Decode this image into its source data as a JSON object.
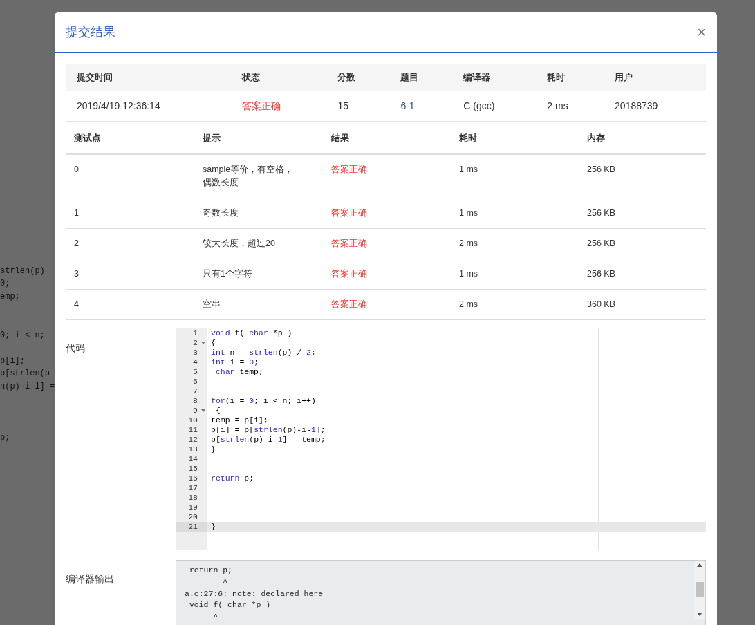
{
  "background_code": [
    [
      "strlen(p)",
      "0;",
      "emp;"
    ],
    [
      "0; i < n;"
    ],
    [
      "p[i];",
      "p[strlen(p",
      "n(p)-i-1] ="
    ],
    [
      "p;"
    ]
  ],
  "modal": {
    "title": "提交结果",
    "close": "×"
  },
  "summary": {
    "columns": [
      "提交时间",
      "状态",
      "分数",
      "题目",
      "编译器",
      "耗时",
      "用户"
    ],
    "row": [
      {
        "text": "2019/4/19 12:36:14",
        "kind": "plain"
      },
      {
        "text": "答案正确",
        "kind": "status"
      },
      {
        "text": "15",
        "kind": "plain"
      },
      {
        "text": "6-1",
        "kind": "link"
      },
      {
        "text": "C (gcc)",
        "kind": "plain"
      },
      {
        "text": "2 ms",
        "kind": "plain"
      },
      {
        "text": "20188739",
        "kind": "plain"
      }
    ]
  },
  "tests": {
    "columns": [
      "测试点",
      "提示",
      "结果",
      "耗时",
      "内存"
    ],
    "rows": [
      {
        "id": "0",
        "hint": "sample等价，有空格，偶数长度",
        "result": "答案正确",
        "time": "1 ms",
        "memory": "256 KB"
      },
      {
        "id": "1",
        "hint": "奇数长度",
        "result": "答案正确",
        "time": "1 ms",
        "memory": "256 KB"
      },
      {
        "id": "2",
        "hint": "较大长度，超过20",
        "result": "答案正确",
        "time": "2 ms",
        "memory": "256 KB"
      },
      {
        "id": "3",
        "hint": "只有1个字符",
        "result": "答案正确",
        "time": "1 ms",
        "memory": "256 KB"
      },
      {
        "id": "4",
        "hint": "空串",
        "result": "答案正确",
        "time": "2 ms",
        "memory": "360 KB"
      }
    ]
  },
  "code": {
    "label": "代码",
    "lines": [
      {
        "number": "1",
        "fold": false,
        "active": false,
        "tokens": [
          {
            "t": "void",
            "kind": "keyword"
          },
          {
            "t": " f( ",
            "kind": "plain"
          },
          {
            "t": "char",
            "kind": "keyword"
          },
          {
            "t": " *p )",
            "kind": "plain"
          }
        ]
      },
      {
        "number": "2",
        "fold": true,
        "active": false,
        "tokens": [
          {
            "t": "{",
            "kind": "plain"
          }
        ]
      },
      {
        "number": "3",
        "fold": false,
        "active": false,
        "tokens": [
          {
            "t": "int",
            "kind": "keyword"
          },
          {
            "t": " n = ",
            "kind": "plain"
          },
          {
            "t": "strlen",
            "kind": "keyword"
          },
          {
            "t": "(p) / ",
            "kind": "plain"
          },
          {
            "t": "2",
            "kind": "number"
          },
          {
            "t": ";",
            "kind": "plain"
          }
        ]
      },
      {
        "number": "4",
        "fold": false,
        "active": false,
        "tokens": [
          {
            "t": "int",
            "kind": "keyword"
          },
          {
            "t": " i = ",
            "kind": "plain"
          },
          {
            "t": "0",
            "kind": "number"
          },
          {
            "t": ";",
            "kind": "plain"
          }
        ]
      },
      {
        "number": "5",
        "fold": false,
        "active": false,
        "tokens": [
          {
            "t": " char",
            "kind": "keyword"
          },
          {
            "t": " temp;",
            "kind": "plain"
          }
        ]
      },
      {
        "number": "6",
        "fold": false,
        "active": false
      },
      {
        "number": "7",
        "fold": false,
        "active": false
      },
      {
        "number": "8",
        "fold": false,
        "active": false,
        "tokens": [
          {
            "t": "for",
            "kind": "keyword"
          },
          {
            "t": "(i = ",
            "kind": "plain"
          },
          {
            "t": "0",
            "kind": "number"
          },
          {
            "t": "; i < n; i++)",
            "kind": "plain"
          }
        ]
      },
      {
        "number": "9",
        "fold": true,
        "active": false,
        "tokens": [
          {
            "t": " {",
            "kind": "plain"
          }
        ]
      },
      {
        "number": "10",
        "fold": false,
        "active": false,
        "tokens": [
          {
            "t": "temp = p[i];",
            "kind": "plain"
          }
        ]
      },
      {
        "number": "11",
        "fold": false,
        "active": false,
        "tokens": [
          {
            "t": "p[i] = p[",
            "kind": "plain"
          },
          {
            "t": "strlen",
            "kind": "keyword"
          },
          {
            "t": "(p)-i-",
            "kind": "plain"
          },
          {
            "t": "1",
            "kind": "number"
          },
          {
            "t": "];",
            "kind": "plain"
          }
        ]
      },
      {
        "number": "12",
        "fold": false,
        "active": false,
        "tokens": [
          {
            "t": "p[",
            "kind": "plain"
          },
          {
            "t": "strlen",
            "kind": "keyword"
          },
          {
            "t": "(p)-i-",
            "kind": "plain"
          },
          {
            "t": "1",
            "kind": "number"
          },
          {
            "t": "] = temp;",
            "kind": "plain"
          }
        ]
      },
      {
        "number": "13",
        "fold": false,
        "active": false,
        "tokens": [
          {
            "t": "}",
            "kind": "plain"
          }
        ]
      },
      {
        "number": "14",
        "fold": false,
        "active": false
      },
      {
        "number": "15",
        "fold": false,
        "active": false
      },
      {
        "number": "16",
        "fold": false,
        "active": false,
        "tokens": [
          {
            "t": "return",
            "kind": "keyword"
          },
          {
            "t": " p;",
            "kind": "plain"
          }
        ]
      },
      {
        "number": "17",
        "fold": false,
        "active": false
      },
      {
        "number": "18",
        "fold": false,
        "active": false
      },
      {
        "number": "19",
        "fold": false,
        "active": false
      },
      {
        "number": "20",
        "fold": false,
        "active": false
      },
      {
        "number": "21",
        "fold": false,
        "active": true,
        "tokens": [
          {
            "t": "}",
            "kind": "plain"
          }
        ]
      }
    ]
  },
  "compiler_output": {
    "label": "编译器输出",
    "lines": [
      " return p;",
      "        ^",
      "a.c:27:6: note: declared here",
      " void f( char *p )",
      "      ^"
    ]
  }
}
